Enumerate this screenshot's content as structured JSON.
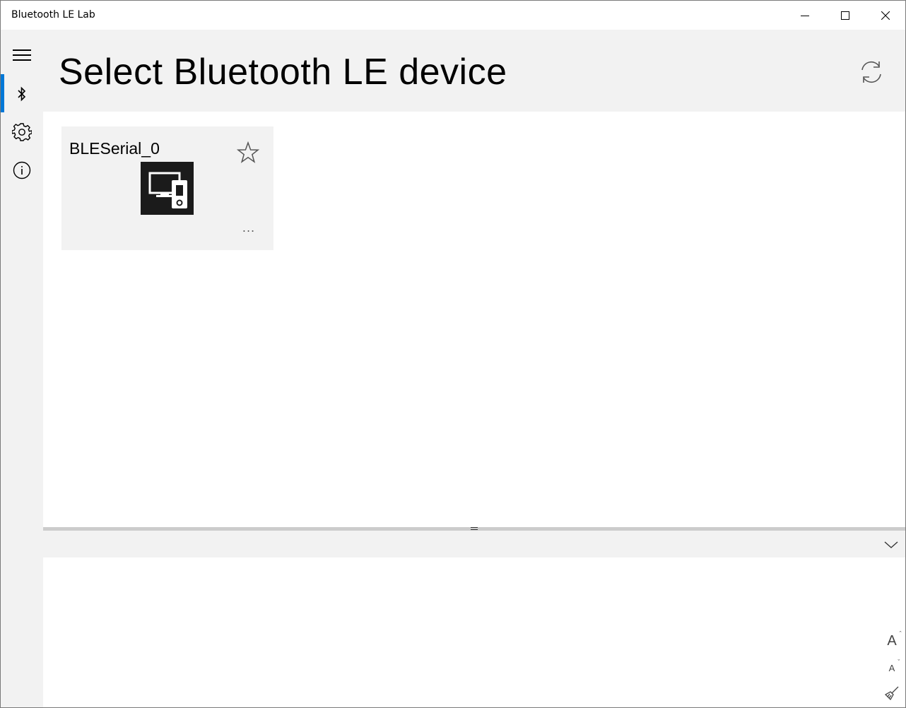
{
  "window": {
    "title": "Bluetooth LE Lab",
    "controls": [
      "minimize-icon",
      "maximize-icon",
      "close-icon"
    ]
  },
  "sidebar": {
    "items": [
      {
        "id": "menu",
        "icon": "hamburger-icon"
      },
      {
        "id": "devices",
        "icon": "bluetooth-icon",
        "selected": true
      },
      {
        "id": "settings",
        "icon": "gear-icon"
      },
      {
        "id": "about",
        "icon": "info-icon"
      }
    ],
    "accent_color": "#0078d7"
  },
  "header": {
    "title": "Select Bluetooth LE device",
    "refresh_icon": "refresh-icon"
  },
  "devices": [
    {
      "name": "BLESerial_0",
      "icon": "devices-icon",
      "favorite_icon": "star-outline-icon",
      "more_label": "..."
    }
  ],
  "log_panel": {
    "collapse_icon": "chevron-down-icon",
    "tools": {
      "font_increase": "A",
      "font_decrease": "A",
      "clear_icon": "broom-icon"
    }
  },
  "colors": {
    "chrome_bg": "#f2f2f2",
    "card_bg": "#f2f2f2",
    "device_icon_bg": "#1b1b1b",
    "splitter": "#cccccc"
  }
}
